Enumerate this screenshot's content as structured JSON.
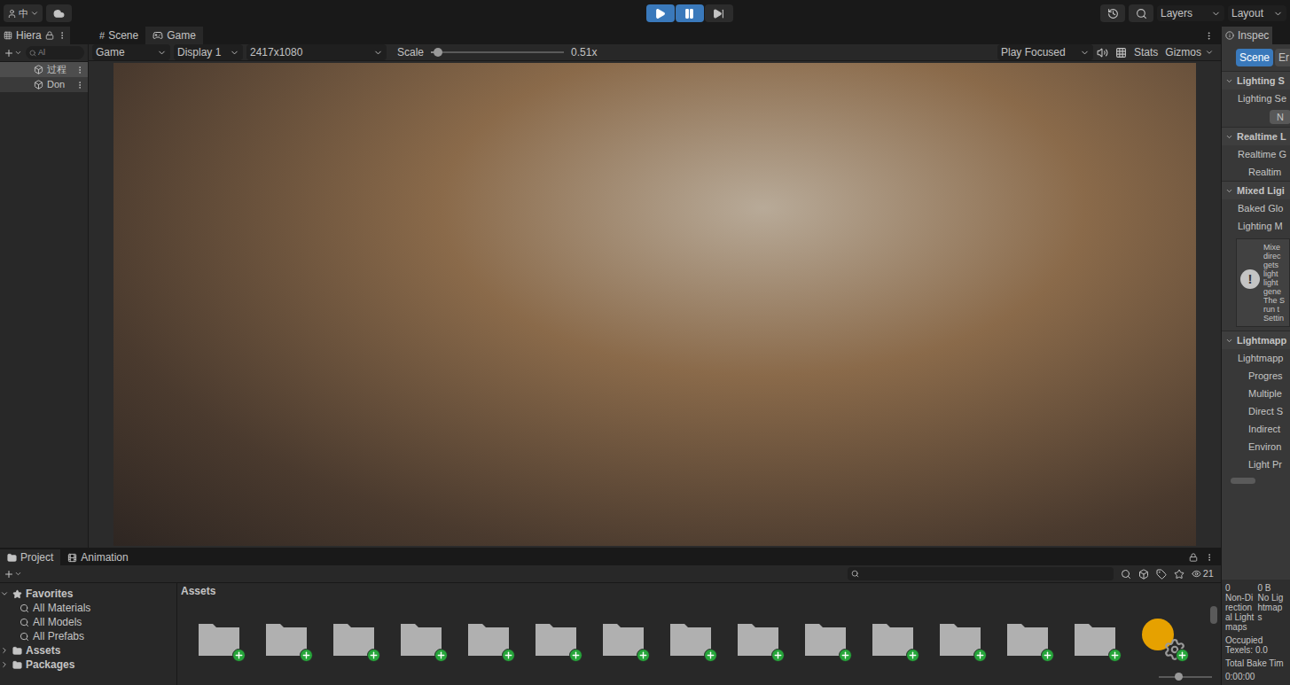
{
  "toolbar": {
    "account": "中",
    "playControls": [
      {
        "kind": "play",
        "selected": true
      },
      {
        "kind": "pause",
        "selected": true
      },
      {
        "kind": "step",
        "selected": false
      }
    ],
    "layers": "Layers",
    "layout": "Layout"
  },
  "hierarchy": {
    "tab": "Hiera",
    "search": "Al",
    "items": [
      {
        "label": "过程",
        "selected": true
      },
      {
        "label": "Don",
        "selected": false
      }
    ]
  },
  "gameView": {
    "tabs": [
      {
        "label": "Scene",
        "icon": "#",
        "selected": false
      },
      {
        "label": "Game",
        "icon": "",
        "selected": true
      }
    ],
    "mode": "Game",
    "display": "Display 1",
    "resolution": "2417x1080",
    "scaleLabel": "Scale",
    "scale": "0.51x",
    "scaleLevel": 0.02,
    "playMode": "Play Focused",
    "muted": false,
    "stats": "Stats",
    "gizmos": "Gizmos"
  },
  "inspector": {
    "tab": "Inspec",
    "tabs": [
      {
        "label": "Scene",
        "selected": true
      },
      {
        "label": "Er",
        "selected": false
      }
    ],
    "sections": [
      {
        "title": "Lighting S",
        "expanded": true,
        "rows": [
          {
            "kind": "label",
            "text": "Lighting Se"
          },
          {
            "kind": "button",
            "text": "N"
          }
        ]
      },
      {
        "title": "Realtime L",
        "expanded": true,
        "rows": [
          {
            "kind": "label",
            "text": "Realtime G"
          },
          {
            "kind": "sublabel",
            "text": "Realtim"
          }
        ]
      },
      {
        "title": "Mixed Ligi",
        "expanded": true,
        "rows": [
          {
            "kind": "label",
            "text": "Baked Glo"
          },
          {
            "kind": "label",
            "text": "Lighting M"
          },
          {
            "kind": "warning",
            "text": "!",
            "lines": [
              "Mixe",
              "direc",
              "gets",
              "light",
              "light",
              "gene",
              "The S",
              "run t",
              "Settin"
            ]
          }
        ]
      },
      {
        "title": "Lightmapp",
        "expanded": true,
        "rows": [
          {
            "kind": "label",
            "text": "Lightmapp"
          },
          {
            "kind": "sublabel",
            "text": "Progres"
          },
          {
            "kind": "sublabel",
            "text": "Multiple"
          },
          {
            "kind": "sublabel",
            "text": "Direct S"
          },
          {
            "kind": "sublabel",
            "text": "Indirect"
          },
          {
            "kind": "sublabel",
            "text": "Environ"
          },
          {
            "kind": "sublabel",
            "text": "Light Pr"
          }
        ]
      }
    ],
    "scrollLevel": 0.4,
    "stats": [
      {
        "value": "0",
        "label": "Non-Directional Lightmaps"
      },
      {
        "value": "0 B",
        "label": "No Lightmaps"
      }
    ],
    "footer": [
      "Occupied Texels: 0.0",
      "Total Bake Tim",
      "0:00:00"
    ]
  },
  "project": {
    "tabs": [
      {
        "label": "Project",
        "selected": true
      },
      {
        "label": "Animation",
        "selected": false
      }
    ],
    "hiddenCount": "21",
    "tree": [
      {
        "label": "Favorites",
        "kind": "group",
        "expanded": true
      },
      {
        "label": "All Materials",
        "kind": "search"
      },
      {
        "label": "All Models",
        "kind": "search"
      },
      {
        "label": "All Prefabs",
        "kind": "search"
      },
      {
        "label": "Assets",
        "kind": "folder",
        "expanded": false
      },
      {
        "label": "Packages",
        "kind": "folder",
        "expanded": false
      }
    ],
    "breadcrumb": "Assets",
    "assets": [
      {
        "kind": "folder",
        "added": true
      },
      {
        "kind": "folder",
        "added": true
      },
      {
        "kind": "folder",
        "added": true
      },
      {
        "kind": "folder",
        "added": true
      },
      {
        "kind": "folder",
        "added": true
      },
      {
        "kind": "folder",
        "added": true
      },
      {
        "kind": "folder",
        "added": true
      },
      {
        "kind": "folder",
        "added": true
      },
      {
        "kind": "folder",
        "added": true
      },
      {
        "kind": "folder",
        "added": true
      },
      {
        "kind": "folder",
        "added": true
      },
      {
        "kind": "folder",
        "added": true
      },
      {
        "kind": "folder",
        "added": true
      },
      {
        "kind": "folder",
        "added": true
      },
      {
        "kind": "settings",
        "added": true
      }
    ],
    "zoomLevel": 0.3
  }
}
